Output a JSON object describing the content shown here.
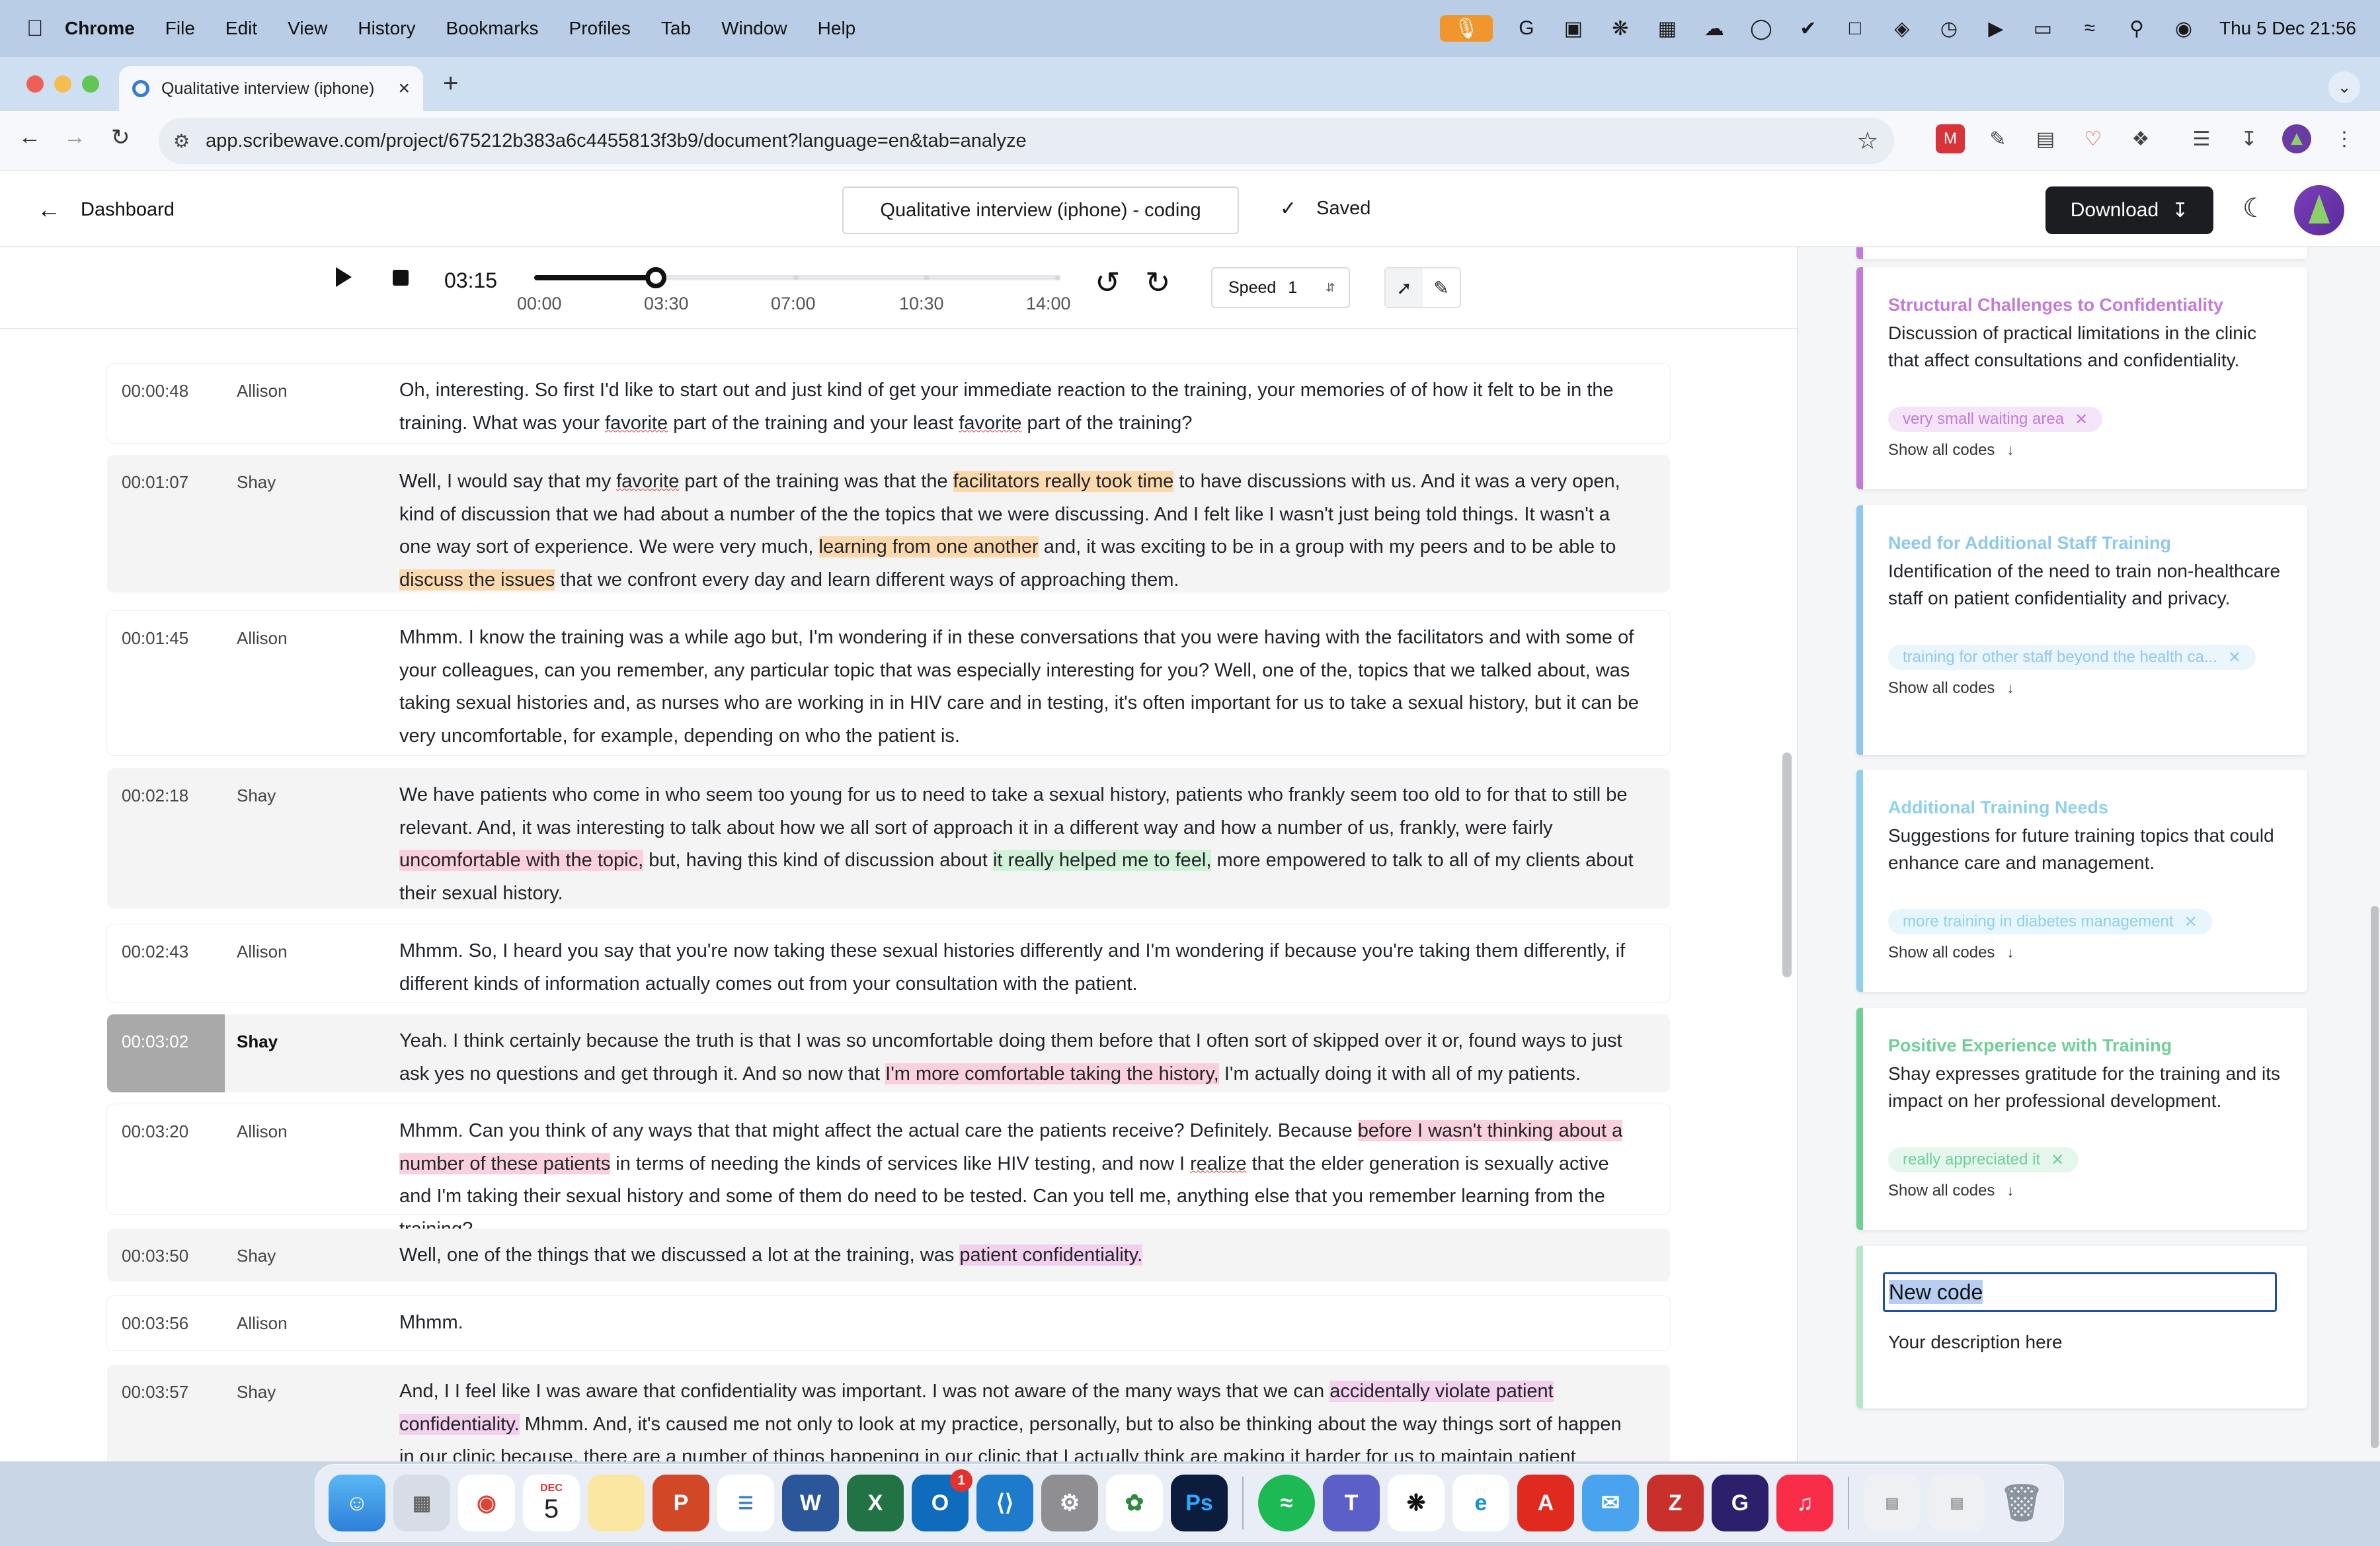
{
  "menubar": {
    "app_name": "Chrome",
    "items": [
      "File",
      "Edit",
      "View",
      "History",
      "Bookmarks",
      "Profiles",
      "Tab",
      "Window",
      "Help"
    ],
    "clock": "Thu 5 Dec  21:56"
  },
  "browser": {
    "tab_title": "Qualitative interview (iphone)",
    "url": "app.scribewave.com/project/675212b383a6c4455813f3b9/document?language=en&tab=analyze"
  },
  "app": {
    "back_label": "Dashboard",
    "document_title": "Qualitative interview (iphone) - coding",
    "saved_label": "Saved",
    "download_label": "Download"
  },
  "player": {
    "current_time": "03:15",
    "ticks": [
      "00:00",
      "03:30",
      "07:00",
      "10:30",
      "14:00"
    ],
    "progress_fraction": 0.232,
    "speed_label": "Speed",
    "speed_value": "1"
  },
  "transcript": [
    {
      "ts": "00:00:48",
      "speaker": "Allison",
      "text": "Oh, interesting. So first I'd like to start out and just kind of get your immediate reaction to the training, your memories of of how it felt to be in the training. What was your favorite part of the training and your least favorite part of the training?"
    },
    {
      "ts": "00:01:07",
      "speaker": "Shay",
      "text": "Well, I would say that my favorite part of the training was that the facilitators really took time to have discussions with us. And it was a very open, kind of discussion that we had about a number of the the topics that we were discussing. And I felt like I wasn't just being told things. It wasn't a one way sort of experience. We were very much, learning from one another and, it was exciting to be in a group with my peers and to be able to discuss the issues that we confront every day and learn different ways of approaching them."
    },
    {
      "ts": "00:01:45",
      "speaker": "Allison",
      "text": "Mhmm. I know the training was a while ago but, I'm wondering if in these conversations that you were having with the facilitators and with some of your colleagues, can you remember, any particular topic that was especially interesting for you? Well, one of the, topics that we talked about, was taking sexual histories and, as nurses who are working in in HIV care and in testing, it's often important for us to take a sexual history, but it can be very uncomfortable, for example, depending on who the patient is."
    },
    {
      "ts": "00:02:18",
      "speaker": "Shay",
      "text": "We have patients who come in who seem too young for us to need to take a sexual history, patients who frankly seem too old to for that to still be relevant. And, it was interesting to talk about how we all sort of approach it in a different way and how a number of us, frankly, were fairly uncomfortable with the topic, but, having this kind of discussion about it really helped me to feel, more empowered to talk to all of my clients about their sexual history."
    },
    {
      "ts": "00:02:43",
      "speaker": "Allison",
      "text": "Mhmm. So, I heard you say that you're now taking these sexual histories differently and I'm wondering if because you're taking them differently, if different kinds of information actually comes out from your consultation with the patient."
    },
    {
      "ts": "00:03:02",
      "speaker": "Shay",
      "text": "Yeah. I think certainly because the truth is that I was so uncomfortable doing them before that I often sort of skipped over it or, found ways to just ask yes no questions and get through it. And so now that I'm more comfortable taking the history, I'm actually doing it with all of my patients."
    },
    {
      "ts": "00:03:20",
      "speaker": "Allison",
      "text": "Mhmm. Can you think of any ways that that might affect the actual care the patients receive? Definitely. Because before I wasn't thinking about a number of these patients in terms of needing the kinds of services like HIV testing, and now I realize that the elder generation is sexually active and I'm taking their sexual history and some of them do need to be tested. Can you tell me, anything else that you remember learning from the training?"
    },
    {
      "ts": "00:03:50",
      "speaker": "Shay",
      "text": "Well, one of the things that we discussed a lot at the training, was patient confidentiality."
    },
    {
      "ts": "00:03:56",
      "speaker": "Allison",
      "text": "Mhmm."
    },
    {
      "ts": "00:03:57",
      "speaker": "Shay",
      "text": "And, I I feel like I was aware that confidentiality was important. I was not aware of the many ways that we can accidentally violate patient confidentiality. Mhmm. And, it's caused me not only to look at my practice, personally, but to also be thinking about the way things sort of happen in our clinic because, there are a number of things happening in our clinic that I actually think are making it harder for us to maintain patient"
    }
  ],
  "codes": [
    {
      "title": "Structural Challenges to Confidentiality",
      "description": "Discussion of practical limitations in the clinic that affect consultations and confidentiality.",
      "chip": "very small waiting area",
      "show_all": "Show all codes",
      "color": "#c47ad9",
      "chip_bg": "#f4e6f8"
    },
    {
      "title": "Need for Additional Staff Training",
      "description": "Identification of the need to train non-healthcare staff on patient confidentiality and privacy.",
      "chip": "training for other staff beyond the health ca...",
      "show_all": "Show all codes",
      "color": "#8fc8ee",
      "chip_bg": "#eaf5fc"
    },
    {
      "title": "Additional Training Needs",
      "description": "Suggestions for future training topics that could enhance care and management.",
      "chip": "more training in diabetes management",
      "show_all": "Show all codes",
      "color": "#8fd0ec",
      "chip_bg": "#e7f6fc"
    },
    {
      "title": "Positive Experience with Training",
      "description": "Shay expresses gratitude for the training and its impact on her professional development.",
      "chip": "really appreciated it",
      "show_all": "Show all codes",
      "color": "#6fcf97",
      "chip_bg": "#e5f7ec"
    }
  ],
  "new_code": {
    "name": "New code",
    "description": "Your description here"
  },
  "dock": {
    "calendar_month": "DEC",
    "calendar_day": "5",
    "outlook_badge": "1"
  }
}
